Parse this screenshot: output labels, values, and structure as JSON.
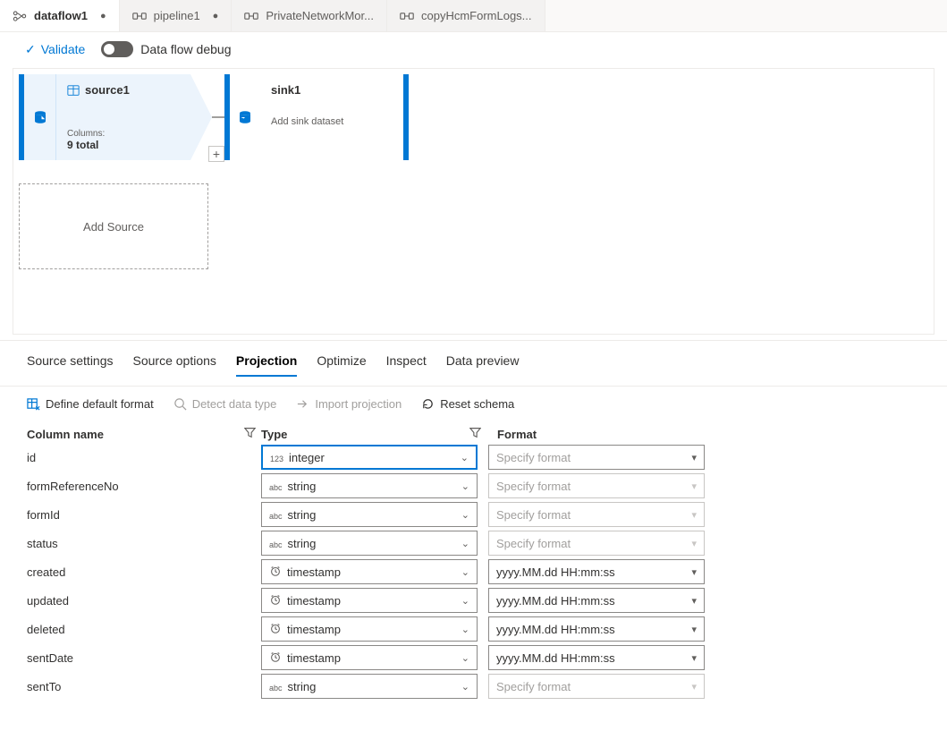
{
  "tabs": [
    {
      "label": "dataflow1",
      "dirty": true,
      "type": "dataflow",
      "active": true
    },
    {
      "label": "pipeline1",
      "dirty": true,
      "type": "pipeline",
      "active": false
    },
    {
      "label": "PrivateNetworkMor...",
      "dirty": false,
      "type": "pipeline",
      "active": false
    },
    {
      "label": "copyHcmFormLogs...",
      "dirty": false,
      "type": "pipeline",
      "active": false
    }
  ],
  "toolbar": {
    "validate": "Validate",
    "debug": "Data flow debug"
  },
  "graph": {
    "source": {
      "title": "source1",
      "cols_label": "Columns:",
      "cols_count": "9 total"
    },
    "sink": {
      "title": "sink1",
      "add_ds": "Add sink dataset"
    },
    "add_source": "Add Source"
  },
  "sections": [
    "Source settings",
    "Source options",
    "Projection",
    "Optimize",
    "Inspect",
    "Data preview"
  ],
  "active_section": "Projection",
  "actions": {
    "define_format": "Define default format",
    "detect": "Detect data type",
    "import_proj": "Import projection",
    "reset": "Reset schema"
  },
  "headers": {
    "name": "Column name",
    "type": "Type",
    "format": "Format"
  },
  "rows": [
    {
      "name": "id",
      "type": "integer",
      "tag": "123",
      "format": "",
      "fmtPlaceholder": "Specify format",
      "fmtEnabled": true,
      "active": true
    },
    {
      "name": "formReferenceNo",
      "type": "string",
      "tag": "abc",
      "format": "",
      "fmtPlaceholder": "Specify format",
      "fmtEnabled": false,
      "active": false
    },
    {
      "name": "formId",
      "type": "string",
      "tag": "abc",
      "format": "",
      "fmtPlaceholder": "Specify format",
      "fmtEnabled": false,
      "active": false
    },
    {
      "name": "status",
      "type": "string",
      "tag": "abc",
      "format": "",
      "fmtPlaceholder": "Specify format",
      "fmtEnabled": false,
      "active": false
    },
    {
      "name": "created",
      "type": "timestamp",
      "tag": "ts",
      "format": "yyyy.MM.dd HH:mm:ss",
      "fmtPlaceholder": "",
      "fmtEnabled": true,
      "active": false
    },
    {
      "name": "updated",
      "type": "timestamp",
      "tag": "ts",
      "format": "yyyy.MM.dd HH:mm:ss",
      "fmtPlaceholder": "",
      "fmtEnabled": true,
      "active": false
    },
    {
      "name": "deleted",
      "type": "timestamp",
      "tag": "ts",
      "format": "yyyy.MM.dd HH:mm:ss",
      "fmtPlaceholder": "",
      "fmtEnabled": true,
      "active": false
    },
    {
      "name": "sentDate",
      "type": "timestamp",
      "tag": "ts",
      "format": "yyyy.MM.dd HH:mm:ss",
      "fmtPlaceholder": "",
      "fmtEnabled": true,
      "active": false
    },
    {
      "name": "sentTo",
      "type": "string",
      "tag": "abc",
      "format": "",
      "fmtPlaceholder": "Specify format",
      "fmtEnabled": false,
      "active": false
    }
  ]
}
